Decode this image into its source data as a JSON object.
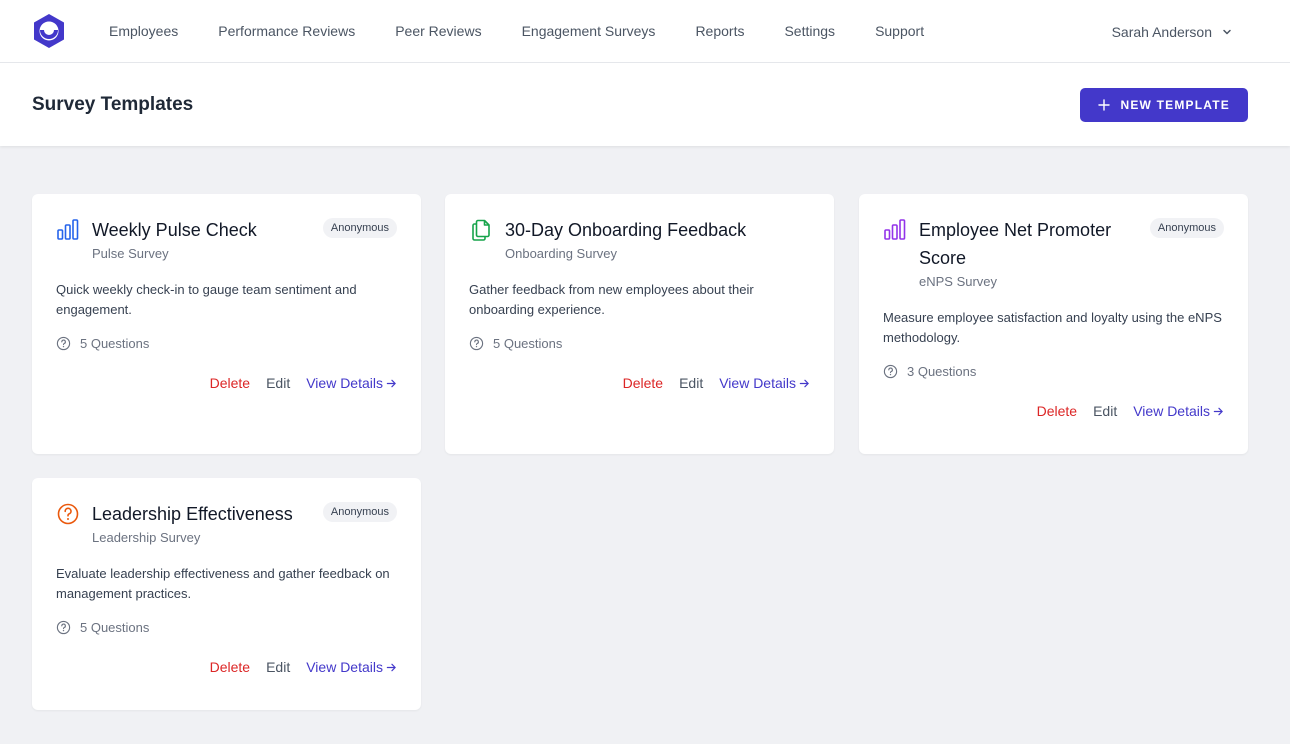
{
  "nav": {
    "items": [
      "Employees",
      "Performance Reviews",
      "Peer Reviews",
      "Engagement Surveys",
      "Reports",
      "Settings",
      "Support"
    ],
    "user_name": "Sarah Anderson"
  },
  "header": {
    "title": "Survey Templates",
    "new_button": "NEW TEMPLATE"
  },
  "actions": {
    "delete": "Delete",
    "edit": "Edit",
    "view": "View Details"
  },
  "colors": {
    "accent": "#4338ca",
    "delete": "#dc2626",
    "pulse_icon": "#2563eb",
    "onboarding_icon": "#16a34a",
    "enps_icon": "#9333ea",
    "leadership_icon": "#ea580c"
  },
  "cards": [
    {
      "icon": "bar-chart-icon",
      "title": "Weekly Pulse Check",
      "subtitle": "Pulse Survey",
      "badge": "Anonymous",
      "description": "Quick weekly check-in to gauge team sentiment and engagement.",
      "questions": "5 Questions"
    },
    {
      "icon": "document-copy-icon",
      "title": "30-Day Onboarding Feedback",
      "subtitle": "Onboarding Survey",
      "badge": "",
      "description": "Gather feedback from new employees about their onboarding experience.",
      "questions": "5 Questions"
    },
    {
      "icon": "bar-chart-icon",
      "title": "Employee Net Promoter Score",
      "subtitle": "eNPS Survey",
      "badge": "Anonymous",
      "description": "Measure employee satisfaction and loyalty using the eNPS methodology.",
      "questions": "3 Questions"
    },
    {
      "icon": "question-circle-icon",
      "title": "Leadership Effectiveness",
      "subtitle": "Leadership Survey",
      "badge": "Anonymous",
      "description": "Evaluate leadership effectiveness and gather feedback on management practices.",
      "questions": "5 Questions"
    }
  ]
}
